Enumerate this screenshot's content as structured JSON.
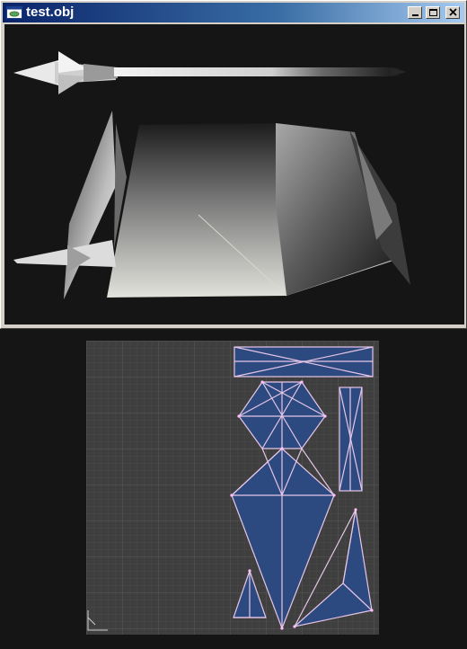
{
  "window": {
    "title": "test.obj",
    "icons": {
      "app": "app-window-icon",
      "minimize": "minimize-icon",
      "maximize": "maximize-icon",
      "close": "close-icon"
    }
  },
  "viewport": {
    "content": "3d-model-preview",
    "background": "#151515"
  },
  "uv_editor": {
    "grid_background": "#3f3f3f",
    "uv_fill": "#2d4a80",
    "uv_edge": "#e6c6e6",
    "axis_gizmo": "axis-gizmo-icon"
  }
}
